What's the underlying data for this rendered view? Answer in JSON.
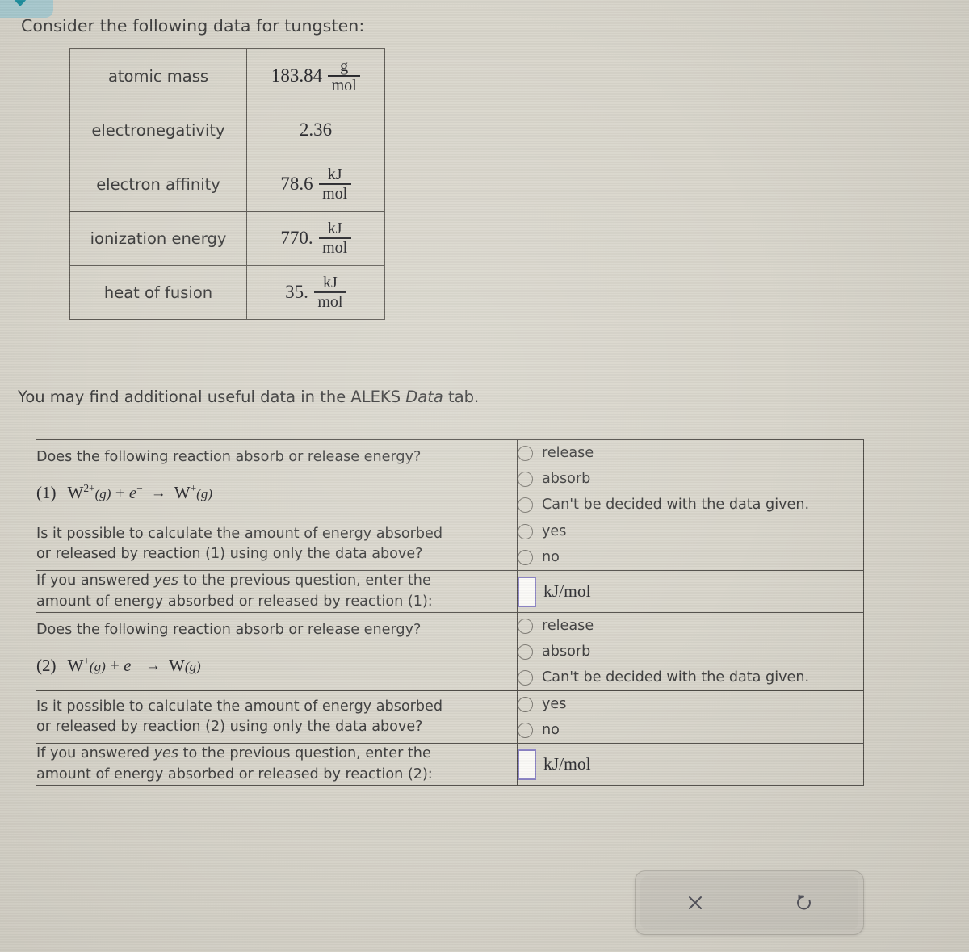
{
  "tab": {
    "icon": "chevron-down-icon"
  },
  "heading": "Consider the following data for tungsten:",
  "data_table": {
    "rows": [
      {
        "label": "atomic mass",
        "value": "183.84",
        "unit_num": "g",
        "unit_den": "mol",
        "has_fraction": true
      },
      {
        "label": "electronegativity",
        "value": "2.36",
        "unit_num": "",
        "unit_den": "",
        "has_fraction": false
      },
      {
        "label": "electron affinity",
        "value": "78.6",
        "unit_num": "kJ",
        "unit_den": "mol",
        "has_fraction": true
      },
      {
        "label": "ionization energy",
        "value": "770.",
        "unit_num": "kJ",
        "unit_den": "mol",
        "has_fraction": true
      },
      {
        "label": "heat of fusion",
        "value": "35.",
        "unit_num": "kJ",
        "unit_den": "mol",
        "has_fraction": true
      }
    ]
  },
  "note": {
    "before": "You may find additional useful data in the ALEKS ",
    "italic": "Data",
    "after": " tab."
  },
  "questions": {
    "q1_prompt": "Does the following reaction absorb or release energy?",
    "q1_eq_label": "(1)",
    "q1_options": [
      {
        "label": "release"
      },
      {
        "label": "absorb"
      },
      {
        "label": "Can't be decided with the data given."
      }
    ],
    "q2_prompt_line1": "Is it possible to calculate the amount of energy absorbed",
    "q2_prompt_line2": "or released by reaction (1) using only the data above?",
    "q2_options": [
      {
        "label": "yes"
      },
      {
        "label": "no"
      }
    ],
    "q3_prompt_line1_a": "If you answered ",
    "q3_prompt_line1_italic": "yes",
    "q3_prompt_line1_b": " to the previous question, enter the",
    "q3_prompt_line2": "amount of energy absorbed or released by reaction (1):",
    "q3_input_value": "",
    "q3_unit": "kJ/mol",
    "q4_prompt": "Does the following reaction absorb or release energy?",
    "q4_eq_label": "(2)",
    "q4_options": [
      {
        "label": "release"
      },
      {
        "label": "absorb"
      },
      {
        "label": "Can't be decided with the data given."
      }
    ],
    "q5_prompt_line1": "Is it possible to calculate the amount of energy absorbed",
    "q5_prompt_line2": "or released by reaction (2) using only the data above?",
    "q5_options": [
      {
        "label": "yes"
      },
      {
        "label": "no"
      }
    ],
    "q6_prompt_line1_a": "If you answered ",
    "q6_prompt_line1_italic": "yes",
    "q6_prompt_line1_b": " to the previous question, enter the",
    "q6_prompt_line2": "amount of energy absorbed or released by reaction (2):",
    "q6_input_value": "",
    "q6_unit": "kJ/mol"
  },
  "equations": {
    "eq1": {
      "label": "(1)",
      "reactant_symbol": "W",
      "reactant_charge": "2+",
      "reactant_state": "(g)",
      "plus": "+",
      "electron": "e",
      "electron_charge": "−",
      "arrow": "→",
      "product_symbol": "W",
      "product_charge": "+",
      "product_state": "(g)"
    },
    "eq2": {
      "label": "(2)",
      "reactant_symbol": "W",
      "reactant_charge": "+",
      "reactant_state": "(g)",
      "plus": "+",
      "electron": "e",
      "electron_charge": "−",
      "arrow": "→",
      "product_symbol": "W",
      "product_charge": "",
      "product_state": "(g)"
    }
  },
  "toolbar": {
    "clear_icon": "close-x-icon",
    "reset_icon": "undo-reset-icon"
  },
  "colors": {
    "page_background": "#d8d5cb",
    "panel_background": "#e3e0d6",
    "border": "#4e4b46",
    "input_border": "#8a82c4",
    "tab_teal": "#a9ccd2",
    "text": "#3c3c3c"
  }
}
